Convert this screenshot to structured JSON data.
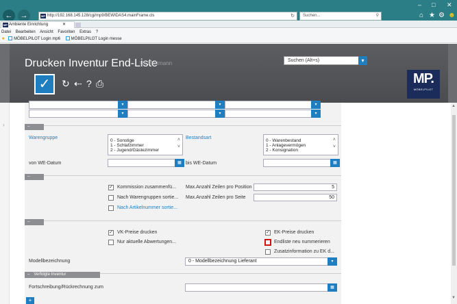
{
  "browser": {
    "url": "http://192.168.145.128/cgi/mp9/BEWIDAS4.mainFrame.cls",
    "search_placeholder": "Suchen...",
    "tab_title": "Ambiente Einrichtung",
    "fav_icon_text": "MP",
    "menu": [
      "Datei",
      "Bearbeiten",
      "Ansicht",
      "Favoriten",
      "Extras",
      "?"
    ],
    "favorites": [
      "MÖBELPILOT Login mp6",
      "MÖBELPILOT Login messe"
    ]
  },
  "app": {
    "title": "Drucken Inventur End-Liste",
    "user": "Uli Flottmann",
    "search_label": "Suchen (Alt+s)",
    "logo_text": "MP.",
    "logo_sub": "MÖBELPILOT",
    "confirm_symbol": "✓"
  },
  "form": {
    "warengruppe_label": "Warengruppe",
    "warengruppe_options": [
      "0 - Sonstige",
      "1 - Schlafzimmer",
      "2 - Jugend/Gästezimmer"
    ],
    "bestandsart_label": "Bestandsart",
    "bestandsart_options": [
      "0 - Warenbestand",
      "1 - Anlagevermögen",
      "2 - Konsignation"
    ],
    "von_datum_label": "von WE-Datum",
    "bis_datum_label": "bis WE-Datum",
    "kommission_label": "Kommission zusammenfü...",
    "warengruppen_sort_label": "Nach Warengruppen sortie...",
    "artikelnummer_sort_label": "Nach Artikelnummer sortie...",
    "max_zeilen_position_label": "Max.Anzahl Zeilen pro Position",
    "max_zeilen_position_value": "5",
    "max_zeilen_seite_label": "Max.Anzahl Zeilen pro Seite",
    "max_zeilen_seite_value": "50",
    "vk_preise_label": "VK-Preise drucken",
    "nur_aktuelle_label": "Nur aktuelle Abwertungen...",
    "ek_preise_label": "EK-Preise drucken",
    "endliste_label": "Endliste neu nummerieren",
    "zusatzinfo_label": "Zusatzinformation zu EK d...",
    "modell_label": "Modellbezeichnung",
    "modell_value": "0 - Modellbezeichnung Lieferant",
    "verfolgte_section": "Verfolgte Inventur",
    "fortschreibung_label": "Fortschreibung/Rückrechnung zum"
  },
  "checkbox_state": {
    "kommission": true,
    "warengruppen_sort": false,
    "vk_preise": true,
    "nur_aktuelle": false,
    "ek_preise": true,
    "endliste": false,
    "zusatzinfo": false
  },
  "colors": {
    "browser_chrome": "#2b7e86",
    "accent_blue": "#1f7ec0",
    "header_gray": "#4a4c4f",
    "logo_navy": "#1b2c5a",
    "highlight_red": "#d01010"
  }
}
